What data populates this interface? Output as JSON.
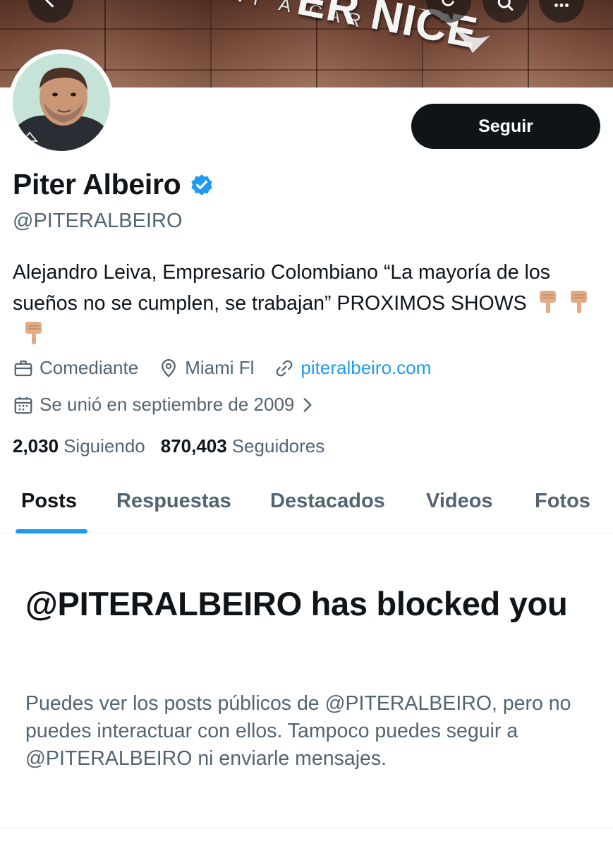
{
  "banner": {
    "logo_text": "ER NICE",
    "logo_sub": "NT A CAR"
  },
  "profile": {
    "name": "Piter Albeiro",
    "handle": "@PITERALBEIRO",
    "follow_label": "Seguir",
    "bio": "Alejandro Leiva, Empresario Colombiano “La mayoría de los sueños no se cumplen, se trabajan” PROXIMOS SHOWS",
    "bio_emojis": [
      "point-down-emoji",
      "point-down-emoji",
      "point-down-emoji"
    ],
    "category": "Comediante",
    "location": "Miami Fl",
    "website": "piteralbeiro.com",
    "joined": "Se unió en septiembre de 2009",
    "following_count": "2,030",
    "following_label": "Siguiendo",
    "followers_count": "870,403",
    "followers_label": "Seguidores"
  },
  "tabs": [
    {
      "label": "Posts",
      "active": true
    },
    {
      "label": "Respuestas",
      "active": false
    },
    {
      "label": "Destacados",
      "active": false
    },
    {
      "label": "Videos",
      "active": false
    },
    {
      "label": "Fotos",
      "active": false
    }
  ],
  "blocked": {
    "title": "@PITERALBEIRO has blocked you",
    "description": "Puedes ver los posts públicos de @PITERALBEIRO, pero no puedes interactuar con ellos. Tampoco puedes seguir a @PITERALBEIRO ni enviarle mensajes."
  },
  "colors": {
    "accent": "#1d9bf0",
    "text_primary": "#0f1419",
    "text_secondary": "#536471",
    "button_bg": "#0f1419"
  },
  "icons": {
    "back": "arrow-left-icon",
    "refresh": "refresh-icon",
    "search": "search-icon",
    "more": "more-icon",
    "verified": "verified-badge-icon",
    "category": "briefcase-icon",
    "location": "location-pin-icon",
    "website": "link-icon",
    "joined": "calendar-icon",
    "chevron": "chevron-right-icon"
  }
}
